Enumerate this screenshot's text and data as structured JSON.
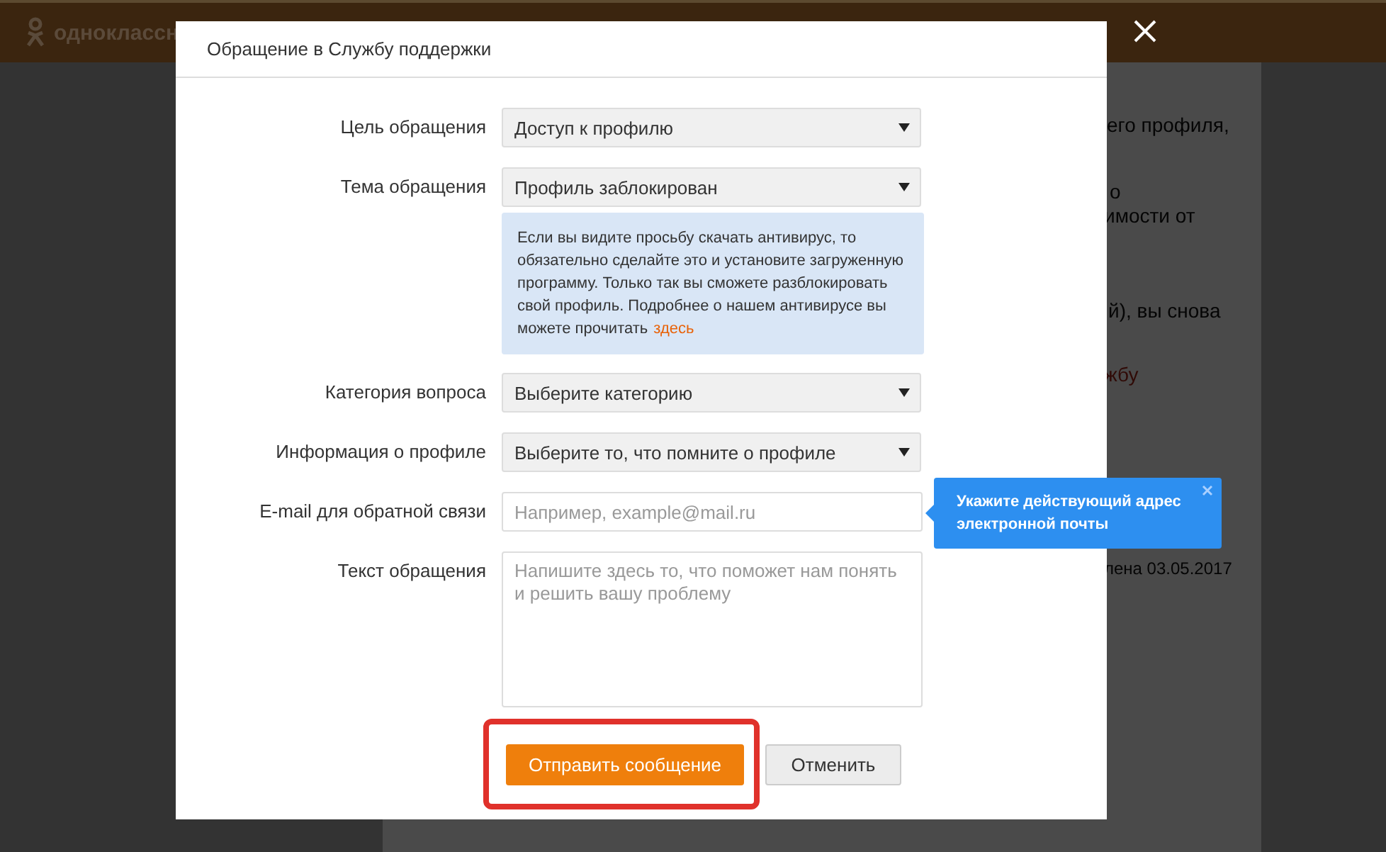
{
  "header": {
    "logo_text": "одноклассн"
  },
  "background_text": [
    {
      "text": "его профиля,",
      "kind": "text"
    },
    {
      "text": "о",
      "kind": "text"
    },
    {
      "text": "имости от",
      "kind": "text"
    },
    {
      "text": "й), вы снова",
      "kind": "text"
    },
    {
      "text": "жбу",
      "kind": "link"
    },
    {
      "text": "лена 03.05.2017",
      "kind": "meta"
    }
  ],
  "dialog": {
    "title": "Обращение в Службу поддержки",
    "fields": [
      {
        "kind": "select",
        "label": "Цель обращения",
        "value": "Доступ к профилю"
      },
      {
        "kind": "select",
        "label": "Тема обращения",
        "value": "Профиль заблокирован"
      },
      {
        "kind": "info",
        "text": "Если вы видите просьбу скачать антивирус, то обязательно сделайте это и установите загруженную программу. Только так вы сможете разблокировать свой профиль. Подробнее о нашем антивирусе вы можете прочитать",
        "link": "здесь"
      },
      {
        "kind": "select",
        "label": "Категория вопроса",
        "placeholder": "Выберите категорию"
      },
      {
        "kind": "select",
        "label": "Информация о профиле",
        "placeholder": "Выберите то, что помните о профиле"
      },
      {
        "kind": "input",
        "label": "E-mail для обратной связи",
        "placeholder": "Например, example@mail.ru",
        "tooltip": "Укажите действующий адрес электронной почты"
      },
      {
        "kind": "textarea",
        "label": "Текст обращения",
        "placeholder": "Напишите здесь то, что поможет нам понять и решить вашу проблему"
      }
    ],
    "submit": "Отправить сообщение",
    "cancel": "Отменить",
    "submit_highlighted": true
  }
}
